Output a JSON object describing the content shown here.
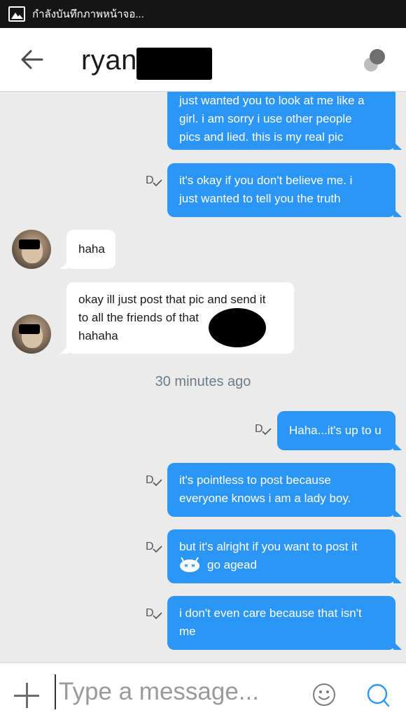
{
  "status_bar": {
    "text": "กำลังบันทึกภาพหน้าจอ..."
  },
  "header": {
    "contact_name": "ryan"
  },
  "receipt_label": "D",
  "messages": [
    {
      "direction": "out",
      "lines": [
        "just wanted you to look at me like a",
        "girl. i am sorry i use other people",
        "pics and lied. this is my real pic"
      ]
    },
    {
      "direction": "out",
      "lines": [
        "it's okay if you don't believe me. i",
        "just wanted to tell you the truth"
      ]
    },
    {
      "direction": "in",
      "lines": [
        "haha"
      ]
    },
    {
      "direction": "in",
      "lines": [
        "okay ill just post that pic and send it",
        "to all the friends of that",
        "hahaha"
      ]
    },
    {
      "direction": "out",
      "lines": [
        "Haha...it's up to u"
      ]
    },
    {
      "direction": "out",
      "lines": [
        "it's pointless to post because",
        "everyone knows i am a lady boy."
      ]
    },
    {
      "direction": "out",
      "lines": [
        "but it's alright if you want to post it",
        "go agead"
      ]
    },
    {
      "direction": "out",
      "lines": [
        "i don't even care because that isn't",
        "me"
      ]
    }
  ],
  "timestamp": "30 minutes ago",
  "composer": {
    "placeholder": "Type a message..."
  },
  "colors": {
    "outgoing": "#2c96f6",
    "incoming": "#ffffff",
    "background": "#ebebeb"
  },
  "icons": [
    "image-icon",
    "back-arrow-icon",
    "status-dots-icon",
    "plus-icon",
    "emoji-icon",
    "send-icon",
    "read-receipt-icon",
    "android-emoji-icon"
  ]
}
